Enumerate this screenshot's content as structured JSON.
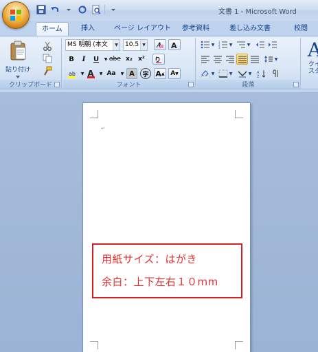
{
  "window": {
    "title": "文書 1 - Microsoft Word",
    "office_button": "office-button",
    "quick_access": [
      "save-icon",
      "undo-icon",
      "redo-icon",
      "print-preview-icon",
      "customize-qat-icon"
    ]
  },
  "tabs": [
    "ホーム",
    "挿入",
    "ページ レイアウト",
    "参考資料",
    "差し込み文書",
    "校閲"
  ],
  "active_tab": "ホーム",
  "ribbon": {
    "clipboard": {
      "label": "クリップボード",
      "paste_label": "貼り付け"
    },
    "font": {
      "label": "フォント",
      "font_name": "MS 明朝 (本文",
      "font_size": "10.5",
      "bold": "B",
      "italic": "I",
      "underline": "U",
      "strike": "abe",
      "subscript": "x₂",
      "superscript": "x²",
      "highlight": "ab",
      "font_color": "A",
      "case": "Aa",
      "char_shading": "A",
      "enclose": "字",
      "grow": "A",
      "shrink": "A",
      "highlight_color": "#ffff00",
      "font_color_value": "#e02020"
    },
    "paragraph": {
      "label": "段落"
    },
    "styles": {
      "label": "クイック スタイル",
      "label_line1": "クイ",
      "label_line2": "スタ",
      "preview": "A"
    }
  },
  "document": {
    "annotation": {
      "line1": "用紙サイズ：はがき",
      "line2": "余白：上下左右１０mm"
    },
    "annotation_color": "#e23030"
  }
}
